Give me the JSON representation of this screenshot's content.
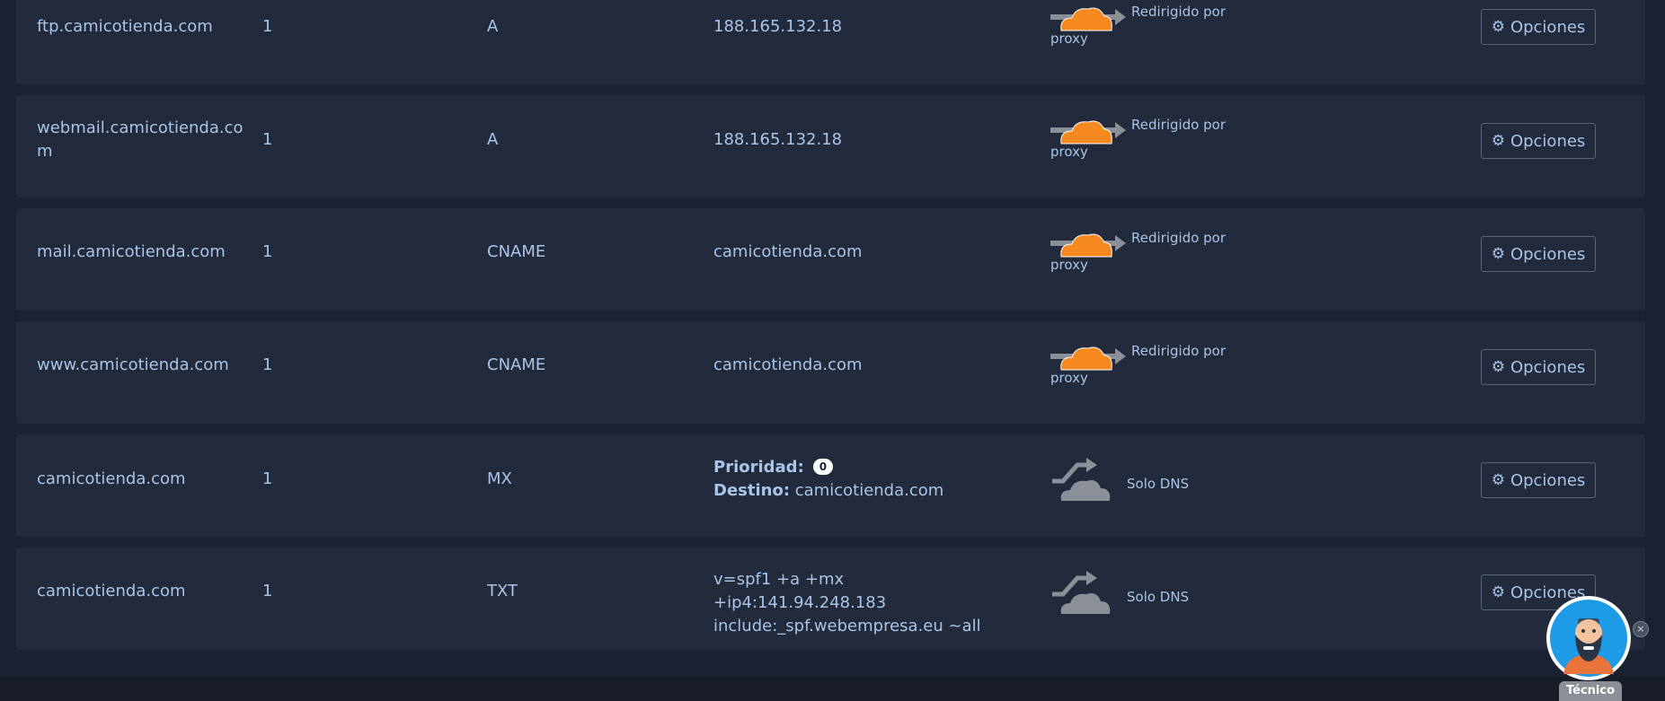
{
  "records": [
    {
      "name": "ftp.camicotienda.com",
      "ttl": "1",
      "type": "A",
      "content": "188.165.132.18",
      "proxy": "on"
    },
    {
      "name": "webmail.camicotienda.co\nm",
      "ttl": "1",
      "type": "A",
      "content": "188.165.132.18",
      "proxy": "on"
    },
    {
      "name": "mail.camicotienda.com",
      "ttl": "1",
      "type": "CNAME",
      "content": "camicotienda.com",
      "proxy": "on"
    },
    {
      "name": "www.camicotienda.com",
      "ttl": "1",
      "type": "CNAME",
      "content": "camicotienda.com",
      "proxy": "on"
    },
    {
      "name": "camicotienda.com",
      "ttl": "1",
      "type": "MX",
      "content": "",
      "proxy": "off"
    },
    {
      "name": "camicotienda.com",
      "ttl": "1",
      "type": "TXT",
      "content": "v=spf1 +a +mx +ip4:141.94.248.183\ninclude:_spf.webempresa.eu ~all",
      "proxy": "off"
    }
  ],
  "proxy_labels": {
    "on_top": "Redirigido por",
    "on_bottom": "proxy",
    "off": "Solo DNS"
  },
  "mx": {
    "priority_label": "Prioridad:",
    "priority_value": "0",
    "target_label": "Destino:",
    "target_value": "camicotienda.com"
  },
  "options_label": "Opciones",
  "assistant": {
    "tag": "Técnico",
    "close": "×"
  },
  "colors": {
    "cloud_on": "#f6891f",
    "cloud_off": "#8a8f98",
    "text": "#a9c4e8",
    "row_bg": "#222a3b"
  }
}
